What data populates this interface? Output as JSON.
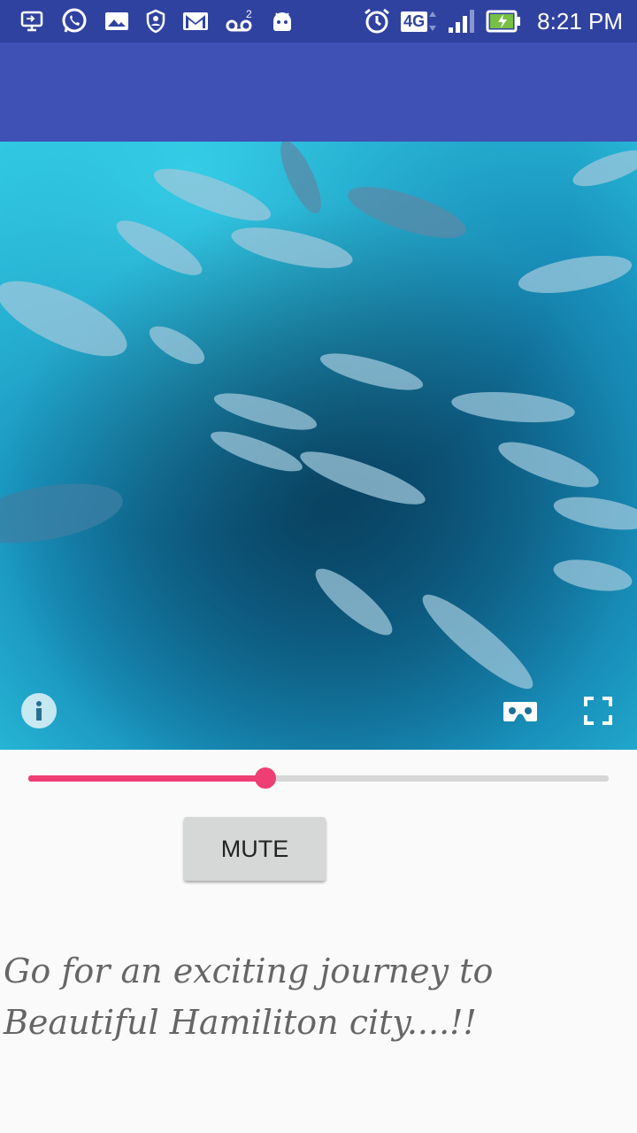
{
  "status_bar": {
    "time": "8:21 PM",
    "network": "4G",
    "voicemail_count": "2",
    "icons": [
      "screen-cast-icon",
      "whatsapp-icon",
      "gallery-icon",
      "shield-icon",
      "gmail-icon",
      "voicemail-icon",
      "android-icon",
      "alarm-icon",
      "network-4g-icon",
      "signal-icon",
      "battery-charging-icon"
    ]
  },
  "player": {
    "video": "underwater school of fish 360 video",
    "controls": [
      "info-icon",
      "cardboard-vr-icon",
      "fullscreen-icon"
    ],
    "progress": 0.408
  },
  "mute_label": "MUTE",
  "caption": "Go for an exciting journey to Beautiful Hamiliton city....!!",
  "colors": {
    "status_bar": "#3042a0",
    "app_bar": "#3f51b5",
    "accent": "#ef3e73",
    "track": "#d6d6d6",
    "background": "#fafafa"
  }
}
